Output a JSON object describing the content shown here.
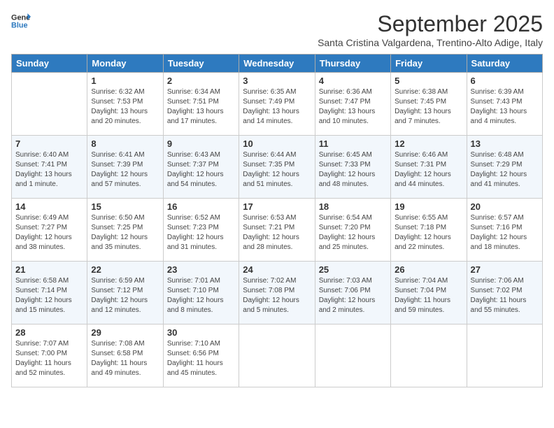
{
  "logo": {
    "line1": "General",
    "line2": "Blue"
  },
  "title": "September 2025",
  "location": "Santa Cristina Valgardena, Trentino-Alto Adige, Italy",
  "weekdays": [
    "Sunday",
    "Monday",
    "Tuesday",
    "Wednesday",
    "Thursday",
    "Friday",
    "Saturday"
  ],
  "weeks": [
    [
      {
        "day": "",
        "sunrise": "",
        "sunset": "",
        "daylight": ""
      },
      {
        "day": "1",
        "sunrise": "Sunrise: 6:32 AM",
        "sunset": "Sunset: 7:53 PM",
        "daylight": "Daylight: 13 hours and 20 minutes."
      },
      {
        "day": "2",
        "sunrise": "Sunrise: 6:34 AM",
        "sunset": "Sunset: 7:51 PM",
        "daylight": "Daylight: 13 hours and 17 minutes."
      },
      {
        "day": "3",
        "sunrise": "Sunrise: 6:35 AM",
        "sunset": "Sunset: 7:49 PM",
        "daylight": "Daylight: 13 hours and 14 minutes."
      },
      {
        "day": "4",
        "sunrise": "Sunrise: 6:36 AM",
        "sunset": "Sunset: 7:47 PM",
        "daylight": "Daylight: 13 hours and 10 minutes."
      },
      {
        "day": "5",
        "sunrise": "Sunrise: 6:38 AM",
        "sunset": "Sunset: 7:45 PM",
        "daylight": "Daylight: 13 hours and 7 minutes."
      },
      {
        "day": "6",
        "sunrise": "Sunrise: 6:39 AM",
        "sunset": "Sunset: 7:43 PM",
        "daylight": "Daylight: 13 hours and 4 minutes."
      }
    ],
    [
      {
        "day": "7",
        "sunrise": "Sunrise: 6:40 AM",
        "sunset": "Sunset: 7:41 PM",
        "daylight": "Daylight: 13 hours and 1 minute."
      },
      {
        "day": "8",
        "sunrise": "Sunrise: 6:41 AM",
        "sunset": "Sunset: 7:39 PM",
        "daylight": "Daylight: 12 hours and 57 minutes."
      },
      {
        "day": "9",
        "sunrise": "Sunrise: 6:43 AM",
        "sunset": "Sunset: 7:37 PM",
        "daylight": "Daylight: 12 hours and 54 minutes."
      },
      {
        "day": "10",
        "sunrise": "Sunrise: 6:44 AM",
        "sunset": "Sunset: 7:35 PM",
        "daylight": "Daylight: 12 hours and 51 minutes."
      },
      {
        "day": "11",
        "sunrise": "Sunrise: 6:45 AM",
        "sunset": "Sunset: 7:33 PM",
        "daylight": "Daylight: 12 hours and 48 minutes."
      },
      {
        "day": "12",
        "sunrise": "Sunrise: 6:46 AM",
        "sunset": "Sunset: 7:31 PM",
        "daylight": "Daylight: 12 hours and 44 minutes."
      },
      {
        "day": "13",
        "sunrise": "Sunrise: 6:48 AM",
        "sunset": "Sunset: 7:29 PM",
        "daylight": "Daylight: 12 hours and 41 minutes."
      }
    ],
    [
      {
        "day": "14",
        "sunrise": "Sunrise: 6:49 AM",
        "sunset": "Sunset: 7:27 PM",
        "daylight": "Daylight: 12 hours and 38 minutes."
      },
      {
        "day": "15",
        "sunrise": "Sunrise: 6:50 AM",
        "sunset": "Sunset: 7:25 PM",
        "daylight": "Daylight: 12 hours and 35 minutes."
      },
      {
        "day": "16",
        "sunrise": "Sunrise: 6:52 AM",
        "sunset": "Sunset: 7:23 PM",
        "daylight": "Daylight: 12 hours and 31 minutes."
      },
      {
        "day": "17",
        "sunrise": "Sunrise: 6:53 AM",
        "sunset": "Sunset: 7:21 PM",
        "daylight": "Daylight: 12 hours and 28 minutes."
      },
      {
        "day": "18",
        "sunrise": "Sunrise: 6:54 AM",
        "sunset": "Sunset: 7:20 PM",
        "daylight": "Daylight: 12 hours and 25 minutes."
      },
      {
        "day": "19",
        "sunrise": "Sunrise: 6:55 AM",
        "sunset": "Sunset: 7:18 PM",
        "daylight": "Daylight: 12 hours and 22 minutes."
      },
      {
        "day": "20",
        "sunrise": "Sunrise: 6:57 AM",
        "sunset": "Sunset: 7:16 PM",
        "daylight": "Daylight: 12 hours and 18 minutes."
      }
    ],
    [
      {
        "day": "21",
        "sunrise": "Sunrise: 6:58 AM",
        "sunset": "Sunset: 7:14 PM",
        "daylight": "Daylight: 12 hours and 15 minutes."
      },
      {
        "day": "22",
        "sunrise": "Sunrise: 6:59 AM",
        "sunset": "Sunset: 7:12 PM",
        "daylight": "Daylight: 12 hours and 12 minutes."
      },
      {
        "day": "23",
        "sunrise": "Sunrise: 7:01 AM",
        "sunset": "Sunset: 7:10 PM",
        "daylight": "Daylight: 12 hours and 8 minutes."
      },
      {
        "day": "24",
        "sunrise": "Sunrise: 7:02 AM",
        "sunset": "Sunset: 7:08 PM",
        "daylight": "Daylight: 12 hours and 5 minutes."
      },
      {
        "day": "25",
        "sunrise": "Sunrise: 7:03 AM",
        "sunset": "Sunset: 7:06 PM",
        "daylight": "Daylight: 12 hours and 2 minutes."
      },
      {
        "day": "26",
        "sunrise": "Sunrise: 7:04 AM",
        "sunset": "Sunset: 7:04 PM",
        "daylight": "Daylight: 11 hours and 59 minutes."
      },
      {
        "day": "27",
        "sunrise": "Sunrise: 7:06 AM",
        "sunset": "Sunset: 7:02 PM",
        "daylight": "Daylight: 11 hours and 55 minutes."
      }
    ],
    [
      {
        "day": "28",
        "sunrise": "Sunrise: 7:07 AM",
        "sunset": "Sunset: 7:00 PM",
        "daylight": "Daylight: 11 hours and 52 minutes."
      },
      {
        "day": "29",
        "sunrise": "Sunrise: 7:08 AM",
        "sunset": "Sunset: 6:58 PM",
        "daylight": "Daylight: 11 hours and 49 minutes."
      },
      {
        "day": "30",
        "sunrise": "Sunrise: 7:10 AM",
        "sunset": "Sunset: 6:56 PM",
        "daylight": "Daylight: 11 hours and 45 minutes."
      },
      {
        "day": "",
        "sunrise": "",
        "sunset": "",
        "daylight": ""
      },
      {
        "day": "",
        "sunrise": "",
        "sunset": "",
        "daylight": ""
      },
      {
        "day": "",
        "sunrise": "",
        "sunset": "",
        "daylight": ""
      },
      {
        "day": "",
        "sunrise": "",
        "sunset": "",
        "daylight": ""
      }
    ]
  ]
}
